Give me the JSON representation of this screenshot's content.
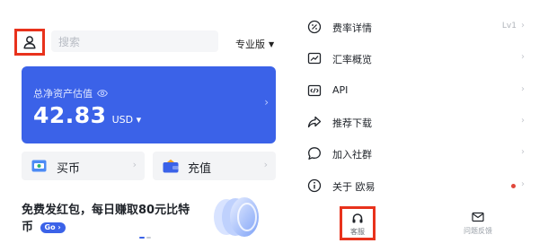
{
  "header": {
    "search_placeholder": "搜索",
    "mode_label": "专业版",
    "mode_caret": "▼"
  },
  "assets": {
    "label": "总净资产估值",
    "value": "42.83",
    "unit": "USD ▾",
    "chevron": "›"
  },
  "quick_actions": [
    {
      "label": "买币",
      "icon": "buy-coin-icon"
    },
    {
      "label": "充值",
      "icon": "deposit-wallet-icon"
    }
  ],
  "promo": {
    "text": "免费发红包，每日赚取80元比特币",
    "go_label": "Go",
    "go_arrow": "›",
    "pages": 2,
    "active_page": 1
  },
  "menu": {
    "items": [
      {
        "label": "费率详情",
        "icon": "fee-rate-icon",
        "badge": "Lv1"
      },
      {
        "label": "汇率概览",
        "icon": "exchange-rate-icon"
      },
      {
        "label": "API",
        "icon": "api-icon"
      },
      {
        "label": "推荐下载",
        "icon": "share-arrow-icon"
      },
      {
        "label": "加入社群",
        "icon": "community-chat-icon"
      },
      {
        "label": "关于 欧易",
        "icon": "info-icon",
        "dot": true
      }
    ],
    "chevron": "›"
  },
  "bottom_tabs": [
    {
      "label": "客服",
      "icon": "headset-icon"
    },
    {
      "label": "问题反馈",
      "icon": "envelope-icon"
    }
  ],
  "colors": {
    "brand_blue": "#3b62e8",
    "highlight_red": "#e8321c",
    "notice_dot": "#e0473b"
  }
}
